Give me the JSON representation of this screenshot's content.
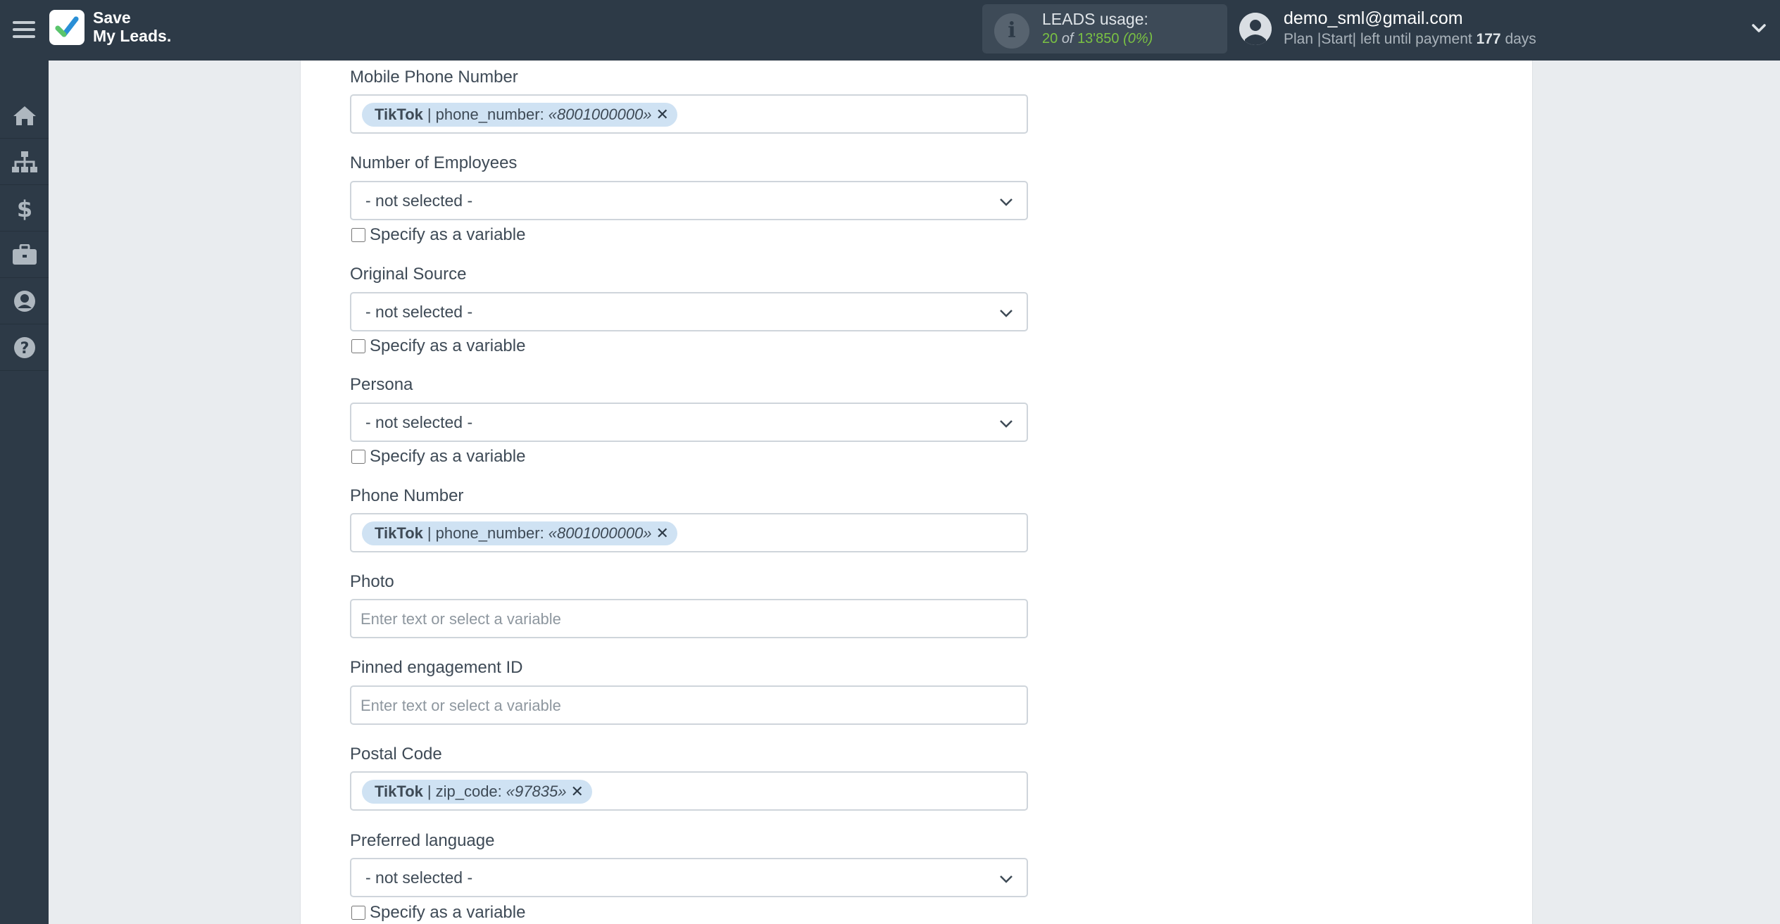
{
  "header": {
    "brand_line1": "Save",
    "brand_line2": "My Leads.",
    "usage_title": "LEADS usage:",
    "usage_used": "20",
    "usage_of": "of",
    "usage_total": "13'850",
    "usage_percent": "(0%)",
    "user_email": "demo_sml@gmail.com",
    "plan_text": "Plan |Start| left until payment",
    "plan_days": "177",
    "plan_days_suffix": "days"
  },
  "sidebar": {
    "items": [
      {
        "icon": "home-icon"
      },
      {
        "icon": "sitemap-icon"
      },
      {
        "icon": "dollar-icon"
      },
      {
        "icon": "briefcase-icon"
      },
      {
        "icon": "user-circle-icon"
      },
      {
        "icon": "help-icon"
      }
    ]
  },
  "form": {
    "checkbox_label": "Specify as a variable",
    "placeholder": "Enter text or select a variable",
    "fields": {
      "mobile_phone": {
        "label": "Mobile Phone Number",
        "tag_source": "TikTok",
        "tag_sep": "|",
        "tag_field": "phone_number:",
        "tag_value": "«8001000000»"
      },
      "employees": {
        "label": "Number of Employees",
        "value": "- not selected -"
      },
      "original_source": {
        "label": "Original Source",
        "value": "- not selected -"
      },
      "persona": {
        "label": "Persona",
        "value": "- not selected -"
      },
      "phone": {
        "label": "Phone Number",
        "tag_source": "TikTok",
        "tag_sep": "|",
        "tag_field": "phone_number:",
        "tag_value": "«8001000000»"
      },
      "photo": {
        "label": "Photo"
      },
      "pinned": {
        "label": "Pinned engagement ID"
      },
      "postal": {
        "label": "Postal Code",
        "tag_source": "TikTok",
        "tag_sep": "|",
        "tag_field": "zip_code:",
        "tag_value": "«97835»"
      },
      "language": {
        "label": "Preferred language",
        "value": "- not selected -"
      }
    }
  },
  "colors": {
    "topbar": "#2d3a47",
    "accent_green": "#7ac143",
    "tag_bg": "#cfe2f3"
  }
}
